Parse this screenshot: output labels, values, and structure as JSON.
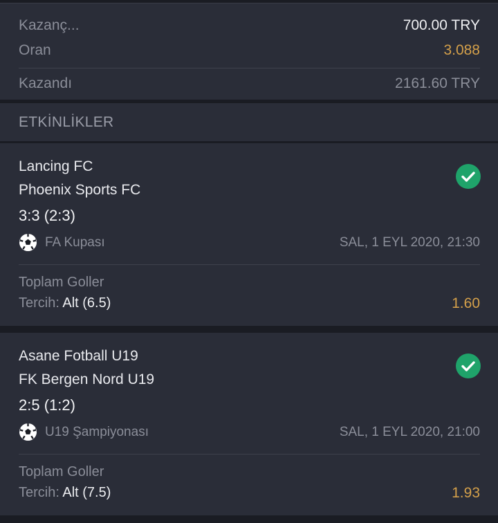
{
  "summary": {
    "winnings_label": "Kazanç...",
    "winnings_value": "700.00 TRY",
    "odds_label": "Oran",
    "odds_value": "3.088",
    "won_label": "Kazandı",
    "won_value": "2161.60 TRY"
  },
  "events_header": "ETKİNLİKLER",
  "events": [
    {
      "home": "Lancing FC",
      "away": "Phoenix Sports FC",
      "score": "3:3 (2:3)",
      "league": "FA Kupası",
      "datetime": "SAL, 1 EYL 2020, 21:30",
      "market": "Toplam Goller",
      "pick_label": "Tercih:",
      "pick_value": "Alt (6.5)",
      "odd": "1.60",
      "status_icon": "check-circle-icon"
    },
    {
      "home": "Asane Fotball U19",
      "away": "FK Bergen Nord U19",
      "score": "2:5 (1:2)",
      "league": "U19 Şampiyonası",
      "datetime": "SAL, 1 EYL 2020, 21:00",
      "market": "Toplam Goller",
      "pick_label": "Tercih:",
      "pick_value": "Alt (7.5)",
      "odd": "1.93",
      "status_icon": "check-circle-icon"
    }
  ],
  "colors": {
    "background": "#1a1c23",
    "panel": "#2a2d38",
    "accent_gold": "#d4a04a",
    "success_green": "#1fa36a"
  }
}
